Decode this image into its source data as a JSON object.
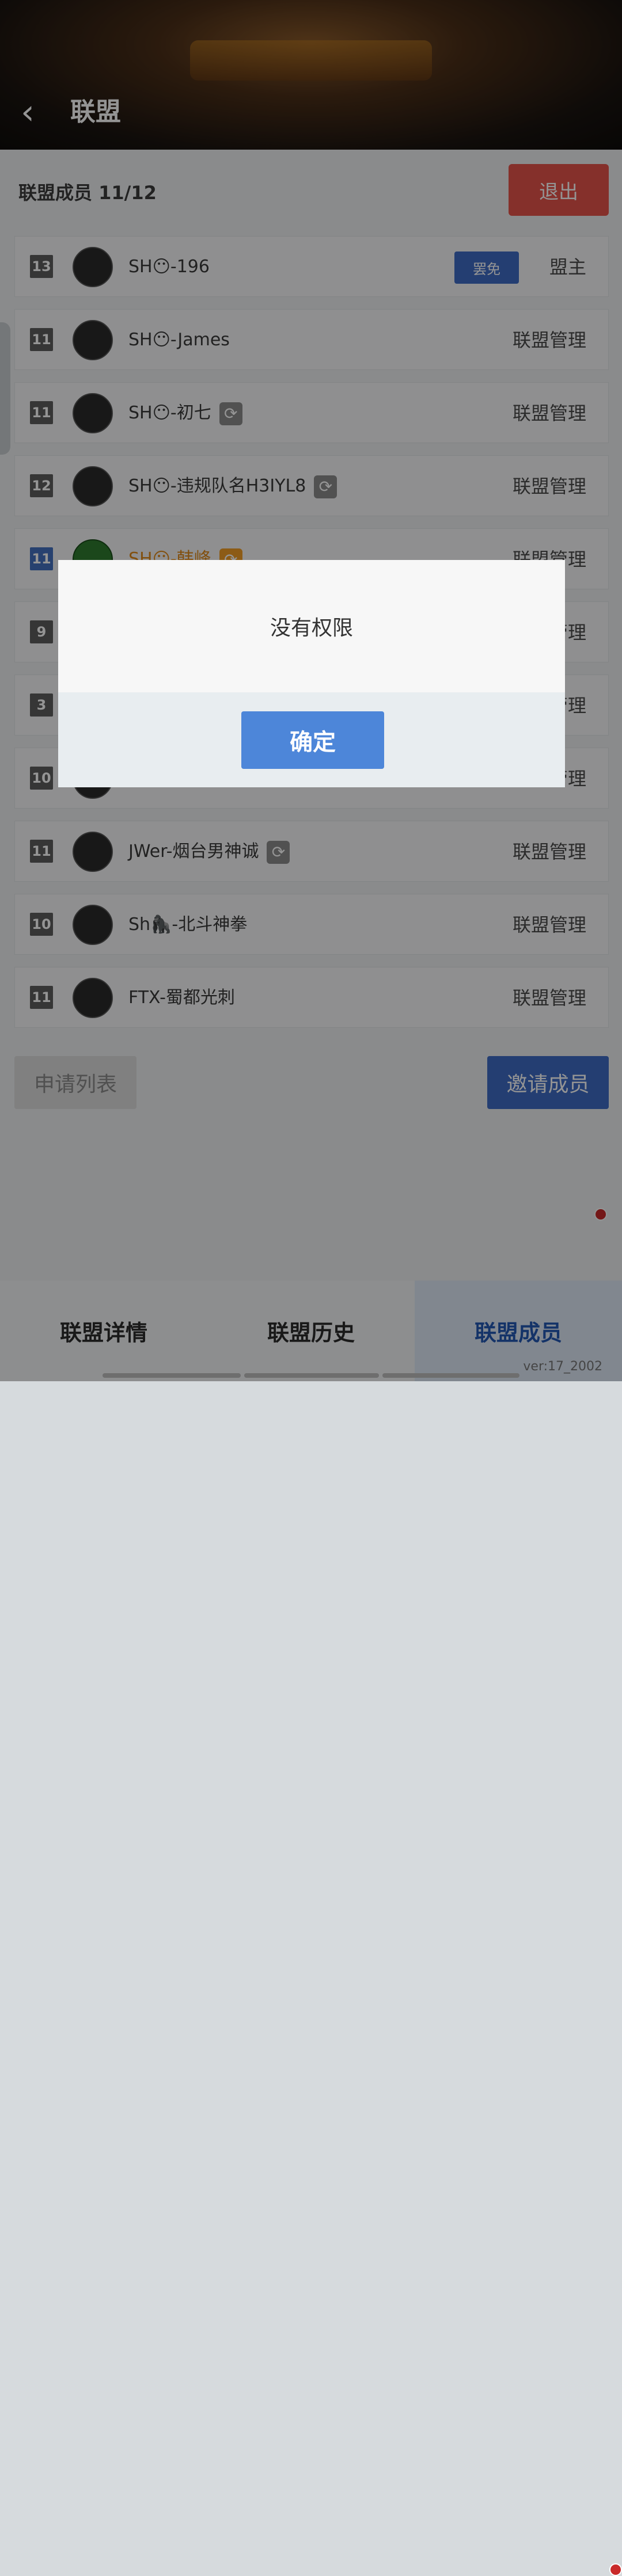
{
  "header": {
    "title": "联盟",
    "back_icon": "chevron-left-icon"
  },
  "members": {
    "count_label": "联盟成员 11/12",
    "exit_label": "退出",
    "rows": [
      {
        "level": "13",
        "name": "SH😶-196",
        "role": "盟主",
        "action": "罢免"
      },
      {
        "level": "11",
        "name": "SH😶-James",
        "role": "联盟管理"
      },
      {
        "level": "11",
        "name": "SH😶-初七",
        "role": "联盟管理"
      },
      {
        "level": "12",
        "name": "SH😶-违规队名H3IYL8",
        "role": "联盟管理"
      },
      {
        "level": "11",
        "name": "SH😶-韩峰",
        "role": "联盟管理"
      },
      {
        "level": "9",
        "name": "",
        "role": "联盟管理"
      },
      {
        "level": "3",
        "name": "",
        "role": "联盟管理"
      },
      {
        "level": "10",
        "name": "",
        "role": "联盟管理"
      },
      {
        "level": "11",
        "name": "JWer-烟台男神诚",
        "role": "联盟管理"
      },
      {
        "level": "10",
        "name": "Sh🦍-北斗神拳",
        "role": "联盟管理"
      },
      {
        "level": "11",
        "name": "FTX-蜀都光刺",
        "role": "联盟管理"
      }
    ]
  },
  "actions": {
    "apply_list": "申请列表",
    "invite": "邀请成员"
  },
  "tabs": [
    "联盟详情",
    "联盟历史",
    "联盟成员"
  ],
  "version": "ver:17_2002",
  "dialog": {
    "message": "没有权限",
    "ok": "确定"
  },
  "colors": {
    "accent": "#3f6cc4",
    "exit": "#e5534b",
    "dialog_button": "#4d86d9"
  }
}
